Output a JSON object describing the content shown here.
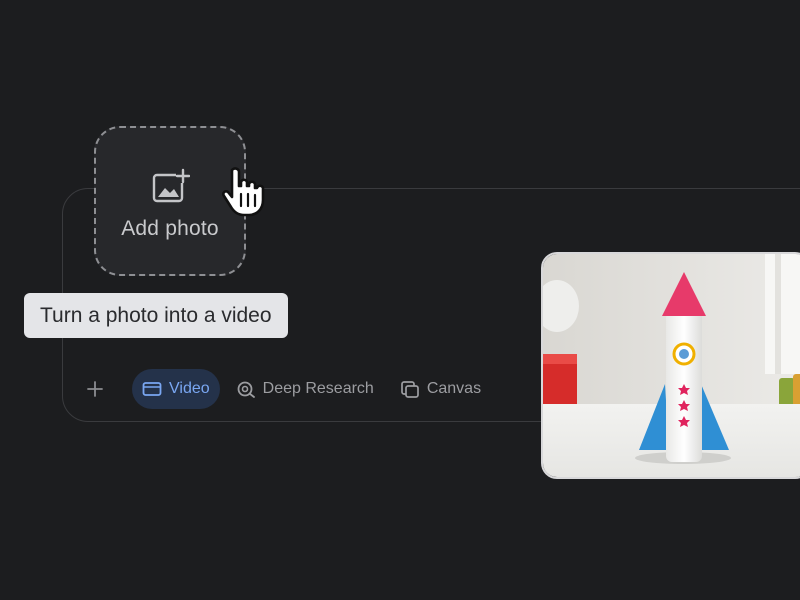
{
  "add_photo": {
    "label": "Add photo",
    "icon": "add-image-icon"
  },
  "tooltip": {
    "text": "Turn a photo into a video"
  },
  "toolbar": {
    "plus_icon": "plus-icon",
    "tools": [
      {
        "label": "Video",
        "icon": "video-icon",
        "active": true
      },
      {
        "label": "Deep Research",
        "icon": "deep-research-icon",
        "active": false
      },
      {
        "label": "Canvas",
        "icon": "canvas-icon",
        "active": false
      }
    ]
  },
  "colors": {
    "background": "#1c1d1f",
    "active_chip_text": "#7aa7f2",
    "active_chip_bg": "#24324a",
    "tooltip_bg": "#e4e5e8"
  },
  "photo": {
    "subject": "paper rocket toy on white table"
  }
}
